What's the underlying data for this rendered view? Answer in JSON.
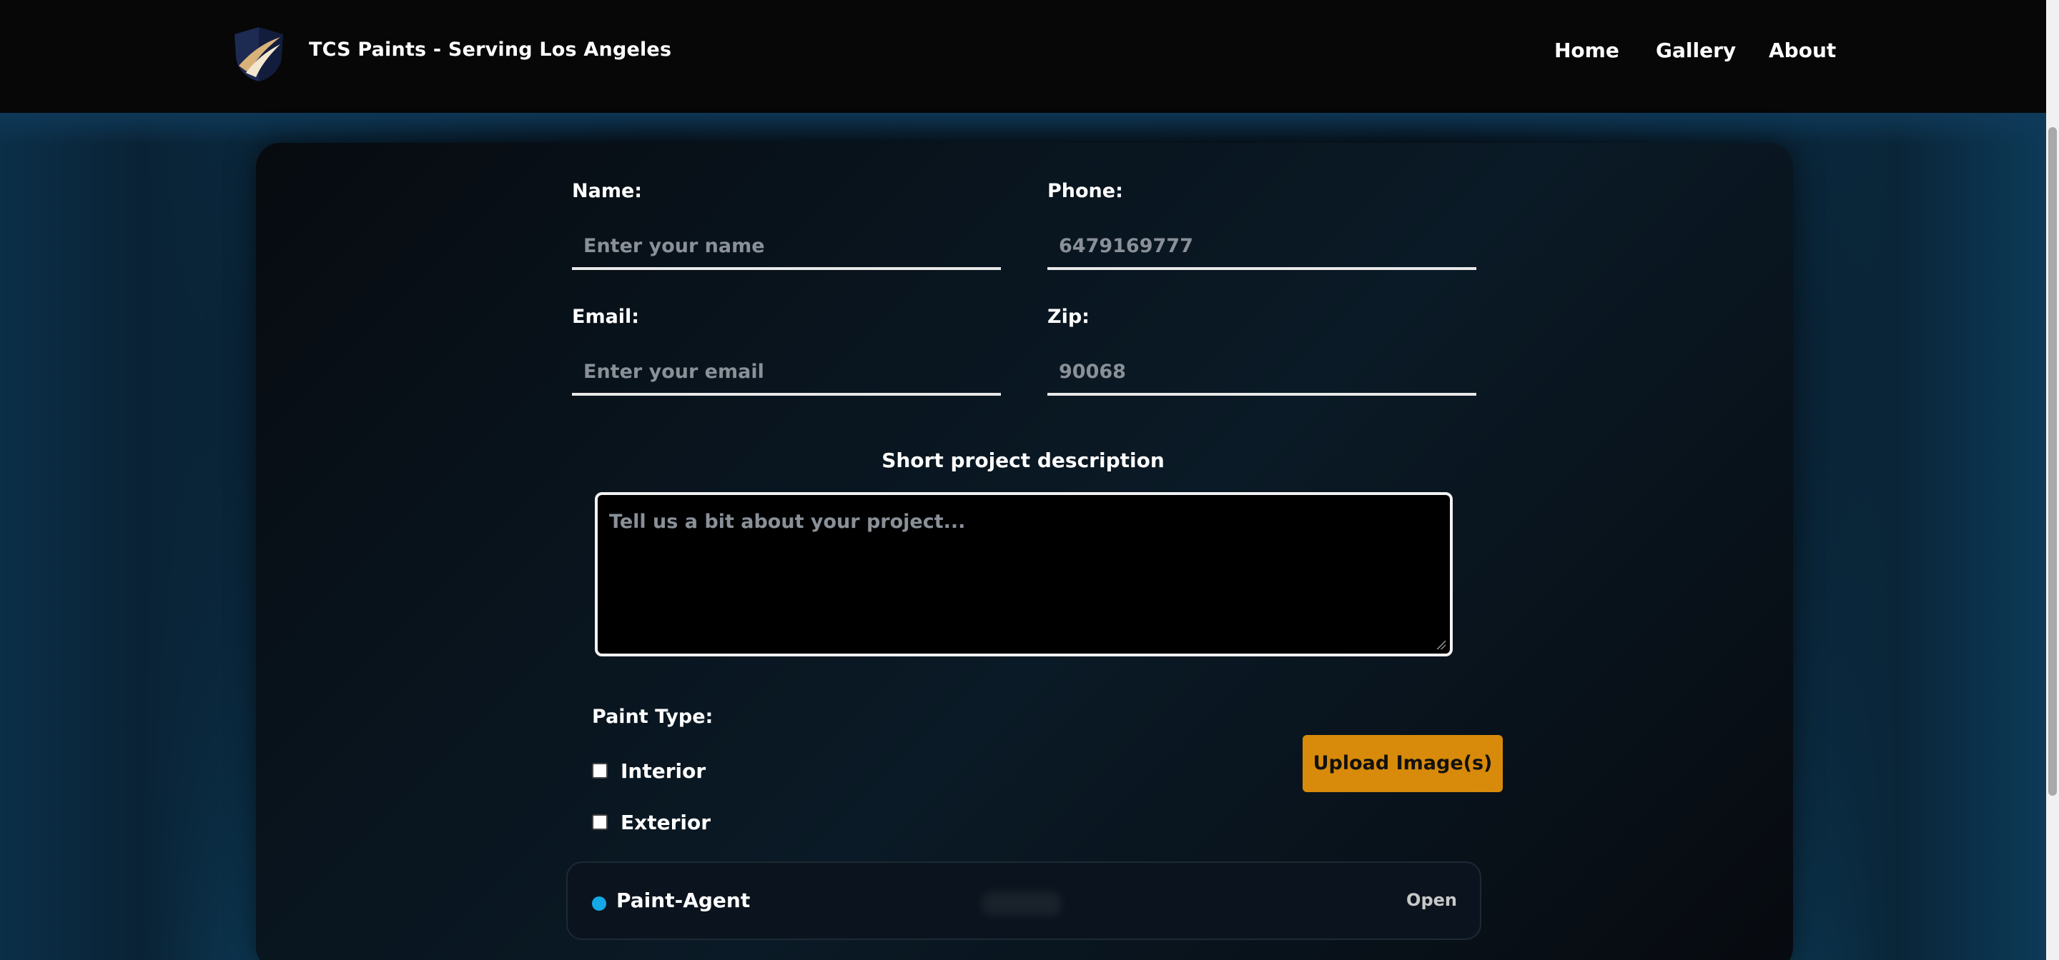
{
  "header": {
    "brand": "TCS Paints - Serving Los Angeles",
    "logo_icon": "shield-logo-icon",
    "nav": [
      {
        "label": "Home"
      },
      {
        "label": "Gallery"
      },
      {
        "label": "About"
      }
    ]
  },
  "form": {
    "name": {
      "label": "Name:",
      "placeholder": "Enter your name",
      "value": ""
    },
    "phone": {
      "label": "Phone:",
      "placeholder": "6479169777",
      "value": ""
    },
    "email": {
      "label": "Email:",
      "placeholder": "Enter your email",
      "value": ""
    },
    "zip": {
      "label": "Zip:",
      "placeholder": "90068",
      "value": ""
    },
    "description": {
      "title": "Short project description",
      "placeholder": "Tell us a bit about your project..."
    },
    "paint_type": {
      "label": "Paint Type:",
      "options": [
        {
          "label": "Interior",
          "checked": false
        },
        {
          "label": "Exterior",
          "checked": false
        }
      ]
    },
    "upload_label": "Upload Image(s)"
  },
  "agent": {
    "name": "Paint-Agent",
    "open_label": "Open",
    "status_color": "#14a9e6"
  },
  "colors": {
    "accent": "#d88a0a",
    "header_bg": "#070707",
    "status_dot": "#14a9e6"
  }
}
